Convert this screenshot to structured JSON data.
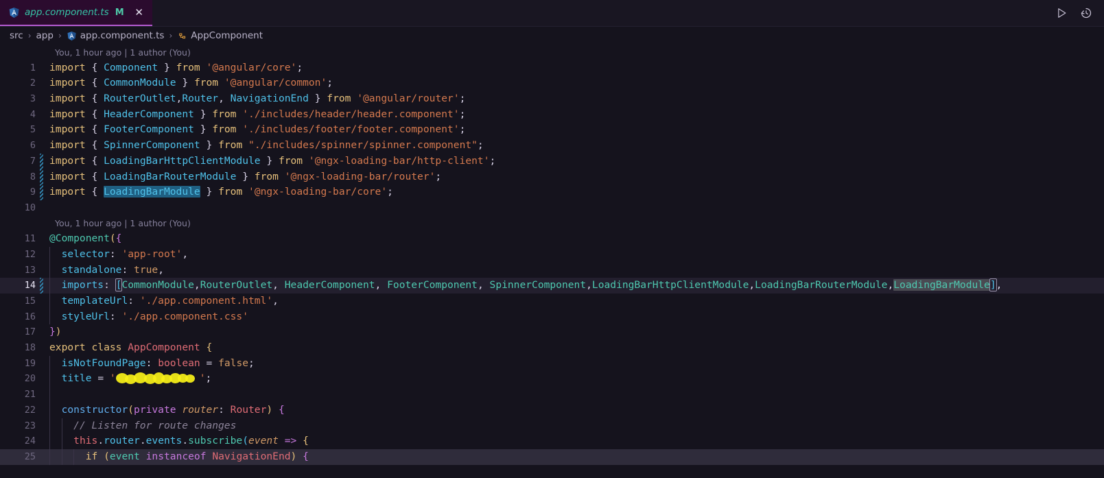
{
  "tab": {
    "icon": "angular-icon",
    "filename": "app.component.ts",
    "modified_badge": "M",
    "close_label": "✕"
  },
  "tabbar_actions": [
    {
      "name": "run-icon",
      "label": "▷"
    },
    {
      "name": "timeline-history-icon",
      "label": "↺"
    }
  ],
  "breadcrumb": {
    "items": [
      {
        "label": "src",
        "icon": null
      },
      {
        "label": "app",
        "icon": null
      },
      {
        "label": "app.component.ts",
        "icon": "angular-icon"
      },
      {
        "label": "AppComponent",
        "icon": "class-symbol-icon"
      }
    ],
    "separator": "›"
  },
  "editor": {
    "blame_top": "You, 1 hour ago | 1 author (You)",
    "blame_mid": "You, 1 hour ago | 1 author (You)",
    "line_numbers": [
      "1",
      "2",
      "3",
      "4",
      "5",
      "6",
      "7",
      "8",
      "9",
      "10",
      "11",
      "12",
      "13",
      "14",
      "15",
      "16",
      "17",
      "18",
      "19",
      "20",
      "21",
      "22",
      "23",
      "24",
      "25"
    ],
    "lines": [
      "import { Component } from '@angular/core';",
      "import { CommonModule } from '@angular/common';",
      "import { RouterOutlet,Router, NavigationEnd } from '@angular/router';",
      "import { HeaderComponent } from './includes/header/header.component';",
      "import { FooterComponent } from './includes/footer/footer.component';",
      "import { SpinnerComponent } from \"./includes/spinner/spinner.component\";",
      "import { LoadingBarHttpClientModule } from '@ngx-loading-bar/http-client';",
      "import { LoadingBarRouterModule } from '@ngx-loading-bar/router';",
      "import { LoadingBarModule } from '@ngx-loading-bar/core';",
      "",
      "@Component({",
      "  selector: 'app-root',",
      "  standalone: true,",
      "  imports: [CommonModule,RouterOutlet, HeaderComponent, FooterComponent, SpinnerComponent,LoadingBarHttpClientModule,LoadingBarRouterModule,LoadingBarModule],",
      "  templateUrl: './app.component.html',",
      "  styleUrl: './app.component.css'",
      "})",
      "export class AppComponent {",
      "  isNotFoundPage: boolean = false;",
      "  title = '████████';",
      "",
      "  constructor(private router: Router) {",
      "    // Listen for route changes",
      "    this.router.events.subscribe(event => {",
      "      if (event instanceof NavigationEnd) {"
    ],
    "active_line": "14",
    "selected_line": "25",
    "selection_word": "LoadingBarModule",
    "occurrence_word": "LoadingBarModule",
    "diff_marked_lines": [
      "7",
      "8",
      "9",
      "14"
    ],
    "redacted_line": "20",
    "redaction_note": "title value obscured by yellow marker"
  },
  "colors": {
    "editor_background": "#15131d",
    "tab_active_background": "#2b0b2e",
    "tab_active_border": "#b45ad0",
    "active_line_background": "#231f2e",
    "selection_background": "#2f2c3b",
    "word_selection_background": "#1f5f82",
    "diff_added_marker": "#2f7fa8",
    "tab_label": "#36c5a7",
    "redaction": "#f7f018"
  }
}
